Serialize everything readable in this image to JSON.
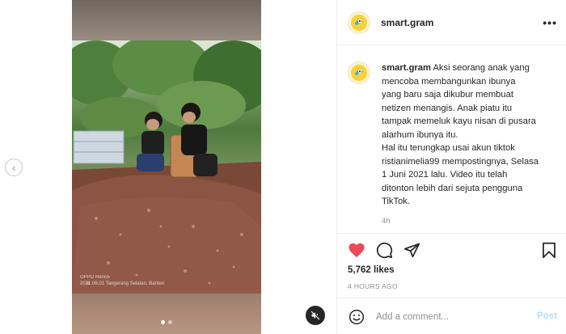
{
  "post": {
    "username": "smart.gram",
    "caption_lines": [
      "Aksi seorang anak yang",
      "mencoba membangunkan ibunya",
      "yang baru saja dikubur membuat",
      "netizen menangis. Anak piatu itu",
      "tampak memeluk kayu nisan di pusara",
      "alarhum ibunya itu.",
      "Hal itu terungkap usai akun tiktok",
      "ristianimelia99 mempostingnya, Selasa",
      "1 Juni 2021 lalu. Video itu telah",
      "ditonton lebih dari sejuta pengguna",
      "TikTok."
    ],
    "caption_age": "4h",
    "likes": "5,762 likes",
    "posted_ago": "4 HOURS AGO"
  },
  "media": {
    "watermark_line1": "OPPO Reno5",
    "watermark_line2": "2021.06.01 Tangerang Selatan, Banten",
    "carousel_index": 1,
    "carousel_count": 2
  },
  "comment": {
    "placeholder": "Add a comment...",
    "post_label": "Post"
  },
  "icons": {
    "more": "more-options-icon",
    "prev": "chevron-left-icon",
    "mute": "speaker-muted-icon",
    "like": "heart-icon",
    "comment": "comment-bubble-icon",
    "share": "paper-plane-icon",
    "save": "bookmark-icon",
    "emoji": "emoji-smile-icon"
  },
  "colors": {
    "like_active": "#ed4956",
    "post_disabled": "#b2dffc",
    "muted_text": "#8e8e8e"
  }
}
